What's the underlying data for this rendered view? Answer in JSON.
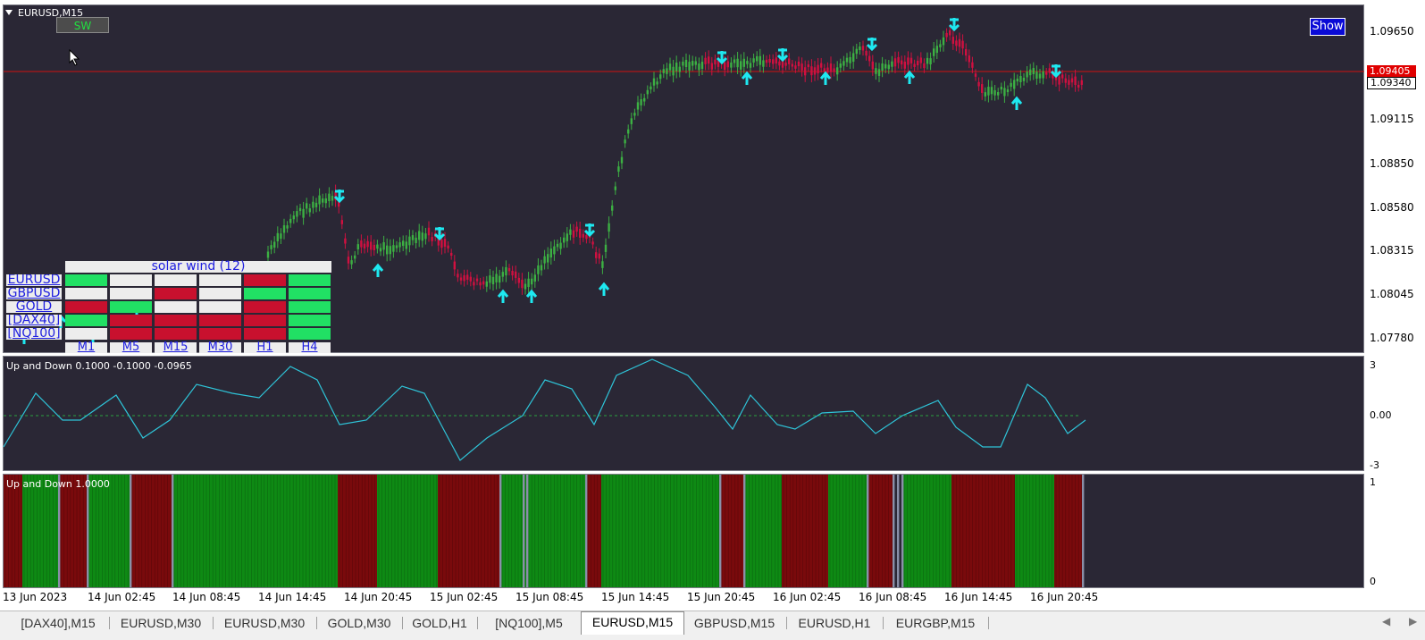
{
  "symbol_title": "EURUSD,M15",
  "sw_button": "SW",
  "show_button": "Show",
  "price_axis": [
    "1.09650",
    "1.09115",
    "1.08850",
    "1.08580",
    "1.08315",
    "1.08045",
    "1.07780"
  ],
  "current_price": "1.09405",
  "bid_price": "1.09340",
  "osc_title": "Up and Down 0.1000 -0.1000 -0.0965",
  "osc_axis": [
    "3",
    "0.00",
    "-3"
  ],
  "hist_title": "Up and Down 1.0000",
  "hist_axis": [
    "1",
    "0"
  ],
  "time_axis": [
    "13 Jun 2023",
    "14 Jun 02:45",
    "14 Jun 08:45",
    "14 Jun 14:45",
    "14 Jun 20:45",
    "15 Jun 02:45",
    "15 Jun 08:45",
    "15 Jun 14:45",
    "15 Jun 20:45",
    "16 Jun 02:45",
    "16 Jun 08:45",
    "16 Jun 14:45",
    "16 Jun 20:45"
  ],
  "dashboard": {
    "title": "solar wind (12)",
    "symbols": [
      "EURUSD",
      "GBPUSD",
      "GOLD",
      "[DAX40]",
      "[NQ100]"
    ],
    "timeframes": [
      "M1",
      "M5",
      "M15",
      "M30",
      "H1",
      "H4"
    ],
    "grid": [
      [
        "green",
        "white",
        "white",
        "white",
        "red",
        "green"
      ],
      [
        "white",
        "white",
        "red",
        "white",
        "green",
        "green"
      ],
      [
        "red",
        "green",
        "white",
        "white",
        "red",
        "green"
      ],
      [
        "green",
        "red",
        "red",
        "red",
        "red",
        "green"
      ],
      [
        "white",
        "red",
        "red",
        "red",
        "red",
        "green"
      ]
    ]
  },
  "colors": {
    "green": "#21e064",
    "red": "#c8102e",
    "white": "#ededed",
    "up_candle": "#3cb043",
    "down_candle": "#d01040",
    "arrow": "#1ee8f0",
    "osc_line": "#2ec4d8",
    "hist_green": "#0e8a14",
    "hist_red": "#7a0a0c"
  },
  "tabs": [
    "[DAX40],M15",
    "EURUSD,M30",
    "EURUSD,M30",
    "GOLD,M30",
    "GOLD,H1",
    "[NQ100],M5",
    "EURUSD,M15",
    "GBPUSD,M15",
    "EURUSD,H1",
    "EURGBP,M15"
  ],
  "active_tab": 6
}
